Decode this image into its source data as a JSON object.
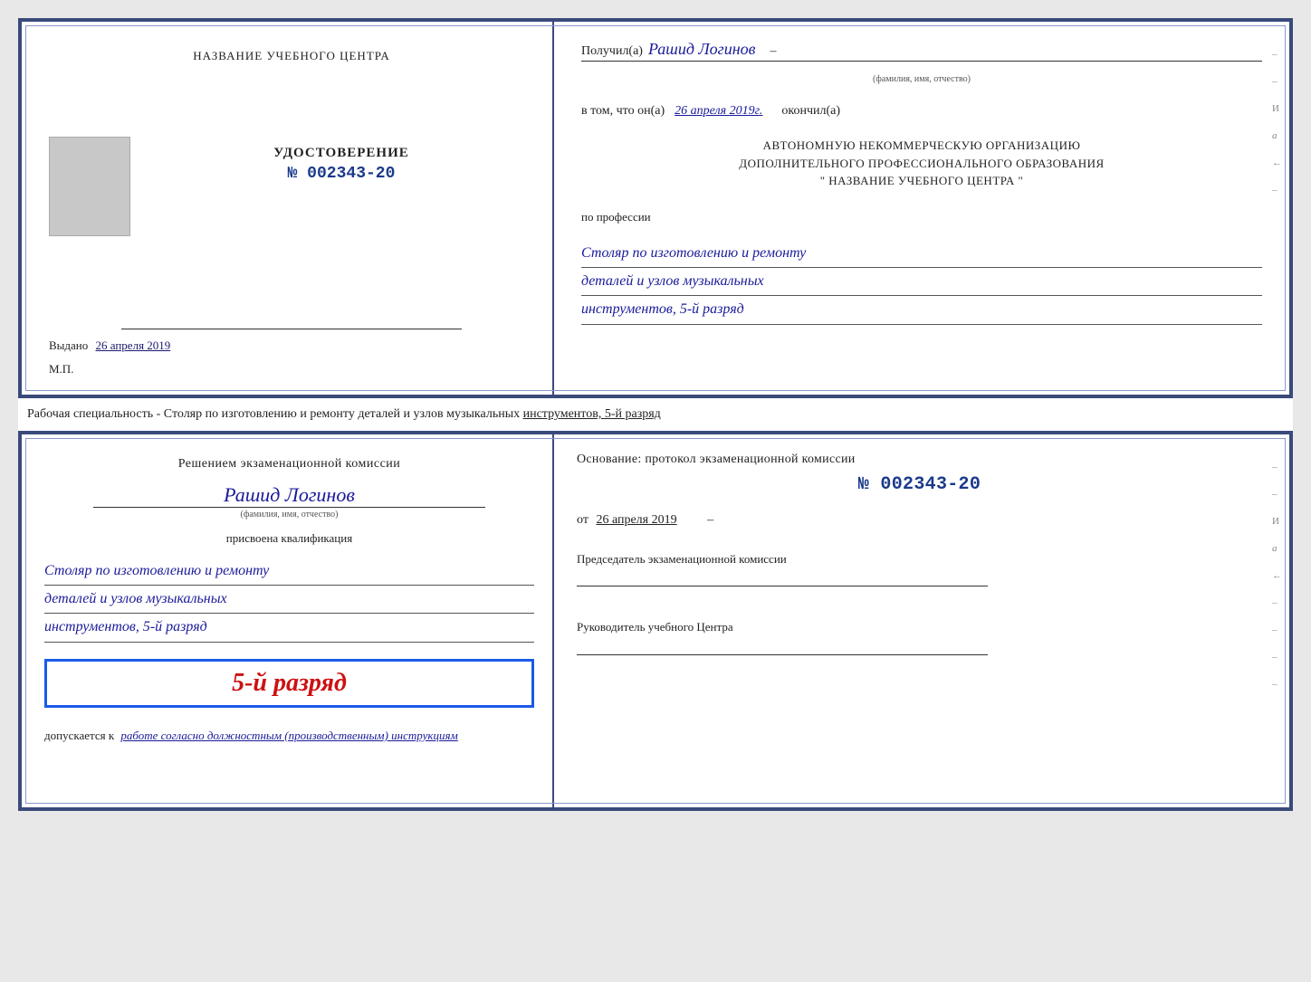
{
  "topCert": {
    "leftSide": {
      "orgName": "НАЗВАНИЕ УЧЕБНОГО ЦЕНТРА",
      "udostoverenie": "УДОСТОВЕРЕНИЕ",
      "number": "№ 002343-20",
      "vydanoLabel": "Выдано",
      "vydanoDate": "26 апреля 2019",
      "mpLabel": "М.П."
    },
    "rightSide": {
      "poluchilLabel": "Получил(а)",
      "recipientName": "Рашид Логинов",
      "fioLabel": "(фамилия, имя, отчество)",
      "vtomChtoLabel": "в том, что он(а)",
      "completionDate": "26 апреля 2019г.",
      "okonchilLabel": "окончил(а)",
      "orgFullLine1": "АВТОНОМНУЮ НЕКОММЕРЧЕСКУЮ ОРГАНИЗАЦИЮ",
      "orgFullLine2": "ДОПОЛНИТЕЛЬНОГО ПРОФЕССИОНАЛЬНОГО ОБРАЗОВАНИЯ",
      "orgFullLine3": "\"   НАЗВАНИЕ УЧЕБНОГО ЦЕНТРА   \"",
      "poProfessiiLabel": "по профессии",
      "profession1": "Столяр по изготовлению и ремонту",
      "profession2": "деталей и узлов музыкальных",
      "profession3": "инструментов, 5-й разряд",
      "edgeLetters": [
        "И",
        "а",
        "←"
      ]
    }
  },
  "separatorText": "Рабочая специальность - Столяр по изготовлению и ремонту деталей и узлов музыкальных инструментов, 5-й разряд",
  "bottomCert": {
    "leftSide": {
      "resheniemLabel": "Решением экзаменационной комиссии",
      "recipientName": "Рашид Логинов",
      "fioLabel": "(фамилия, имя, отчество)",
      "prisvoenaLabel": "присвоена квалификация",
      "qual1": "Столяр по изготовлению и ремонту",
      "qual2": "деталей и узлов музыкальных",
      "qual3": "инструментов, 5-й разряд",
      "razryadText": "5-й разряд",
      "dopuskaetsyaLabel": "допускается к",
      "dopuskaetsyaWork": "работе согласно должностным (производственным) инструкциям"
    },
    "rightSide": {
      "osnovanieLabelFull": "Основание: протокол экзаменационной комиссии",
      "protoNum": "№ 002343-20",
      "otLabel": "от",
      "otDate": "26 апреля 2019",
      "predsedatelLabel": "Председатель экзаменационной комиссии",
      "rukovoditelLabel": "Руководитель учебного Центра",
      "edgeLetters": [
        "И",
        "а",
        "←"
      ]
    }
  }
}
